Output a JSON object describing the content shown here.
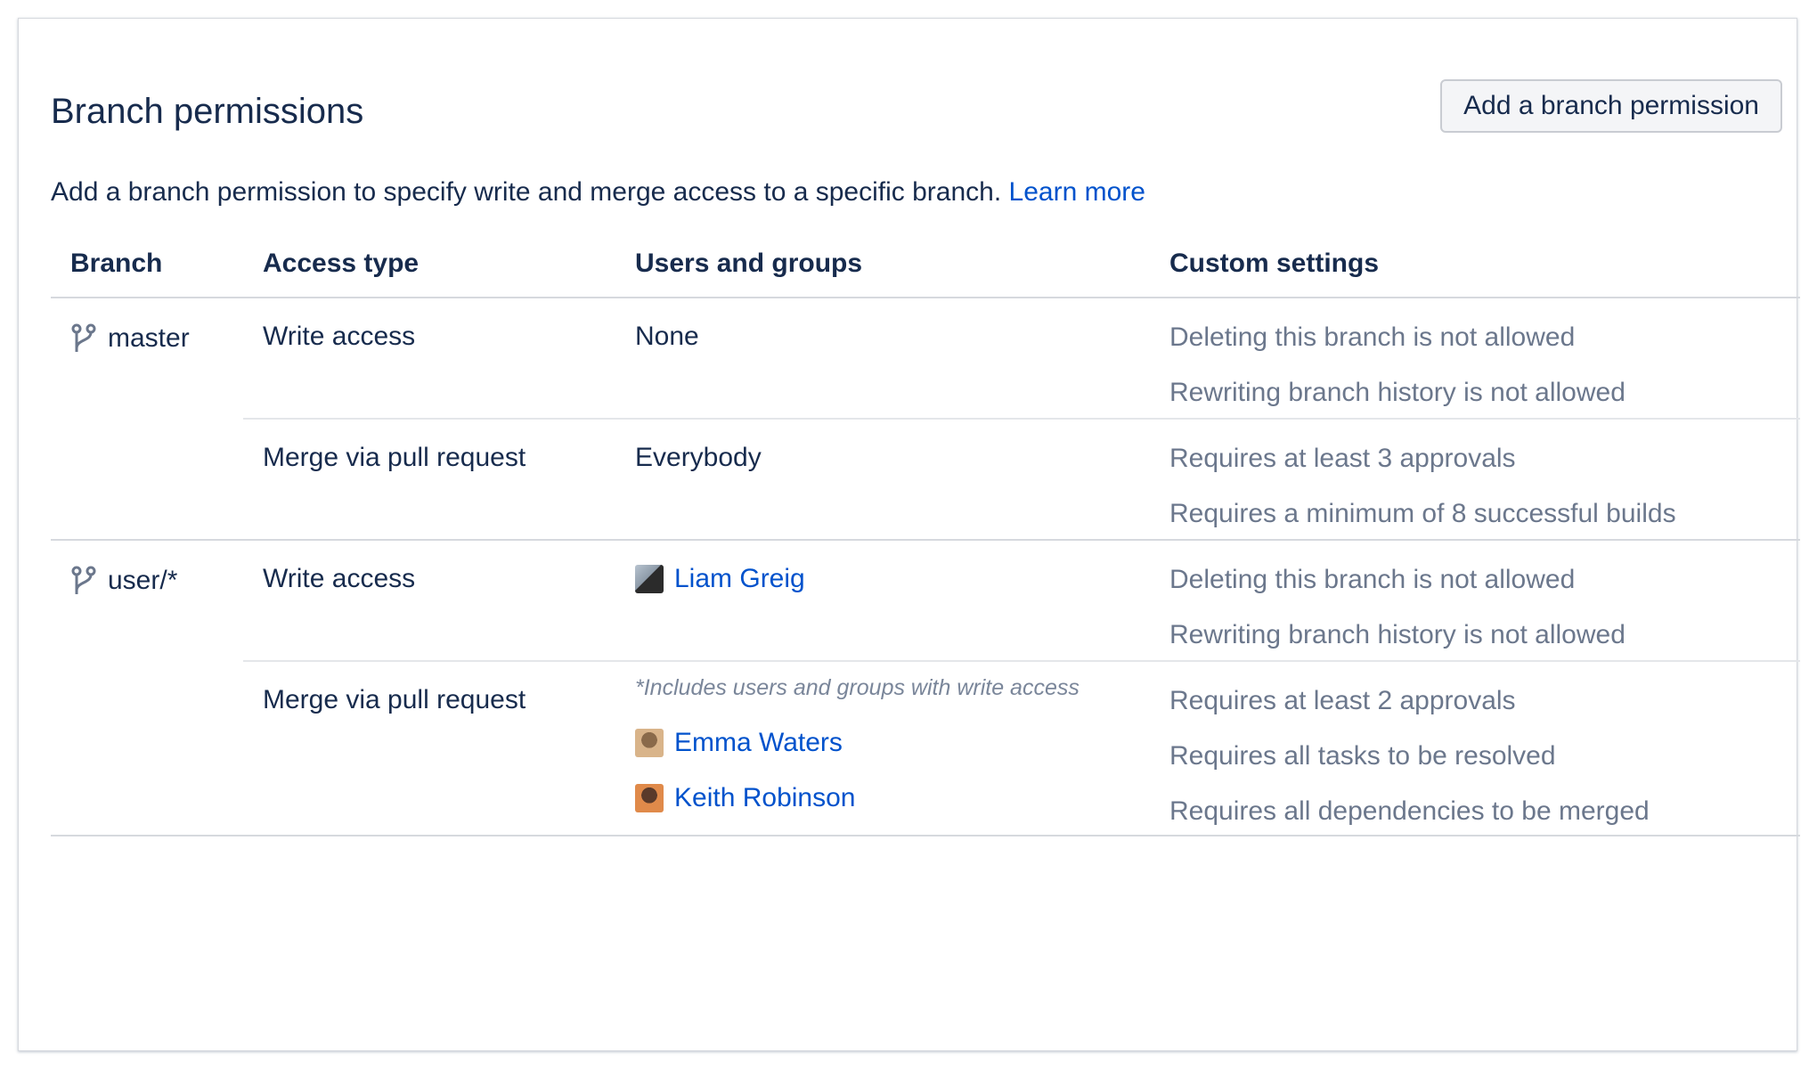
{
  "page": {
    "title": "Branch permissions",
    "add_button": "Add a branch permission",
    "description": "Add a branch permission to specify write and merge access to a specific branch.",
    "learn_more": "Learn more"
  },
  "table": {
    "headers": [
      "Branch",
      "Access type",
      "Users and groups",
      "Custom settings"
    ],
    "branches": [
      {
        "name": "master",
        "rows": [
          {
            "access": "Write access",
            "users_text": "None",
            "settings": [
              "Deleting this branch is not allowed",
              "Rewriting branch history is not allowed"
            ]
          },
          {
            "access": "Merge via pull request",
            "users_text": "Everybody",
            "settings": [
              "Requires at least 3 approvals",
              "Requires a minimum of 8 successful builds"
            ]
          }
        ]
      },
      {
        "name": "user/*",
        "rows": [
          {
            "access": "Write access",
            "users": [
              "Liam Greig"
            ],
            "settings": [
              "Deleting this branch is not allowed",
              "Rewriting branch history is not allowed"
            ]
          },
          {
            "access": "Merge via pull request",
            "note": "*Includes users and groups with write access",
            "users": [
              "Emma Waters",
              "Keith Robinson"
            ],
            "settings": [
              "Requires at least 2 approvals",
              "Requires all tasks to be resolved",
              "Requires all dependencies to be merged"
            ]
          }
        ]
      }
    ]
  },
  "colors": {
    "link": "#0052cc",
    "muted": "#6b778c",
    "text": "#172b4d",
    "border": "#d6d9de"
  },
  "icons": {
    "branch": "branch-icon",
    "avatar": "user-avatar"
  }
}
